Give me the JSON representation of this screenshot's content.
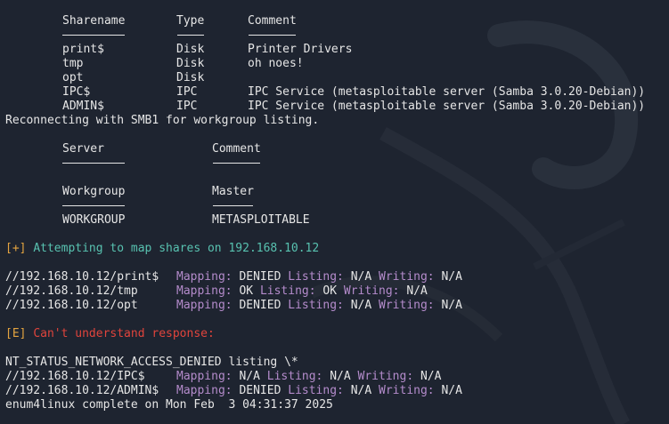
{
  "share_table": {
    "headers": {
      "name": "Sharename",
      "type": "Type",
      "comment": "Comment"
    },
    "rows": [
      {
        "name": "print$",
        "type": "Disk",
        "comment": "Printer Drivers"
      },
      {
        "name": "tmp",
        "type": "Disk",
        "comment": "oh noes!"
      },
      {
        "name": "opt",
        "type": "Disk",
        "comment": ""
      },
      {
        "name": "IPC$",
        "type": "IPC",
        "comment": "IPC Service (metasploitable server (Samba 3.0.20-Debian))"
      },
      {
        "name": "ADMIN$",
        "type": "IPC",
        "comment": "IPC Service (metasploitable server (Samba 3.0.20-Debian))"
      }
    ]
  },
  "reconnect_message": "Reconnecting with SMB1 for workgroup listing.",
  "server_table": {
    "headers": {
      "server": "Server",
      "comment": "Comment"
    }
  },
  "workgroup_table": {
    "headers": {
      "workgroup": "Workgroup",
      "master": "Master"
    },
    "row": {
      "workgroup": "WORKGROUP",
      "master": "METASPLOITABLE"
    }
  },
  "status_map": {
    "tag": "[+]",
    "text": "Attempting to map shares on 192.168.10.12"
  },
  "labels": {
    "mapping": "Mapping:",
    "listing": "Listing:",
    "writing": "Writing:"
  },
  "share_results": [
    {
      "path": "//192.168.10.12/print$",
      "mapping": "DENIED",
      "listing": "N/A",
      "writing": "N/A"
    },
    {
      "path": "//192.168.10.12/tmp",
      "mapping": "OK",
      "listing": "OK",
      "writing": "N/A"
    },
    {
      "path": "//192.168.10.12/opt",
      "mapping": "DENIED",
      "listing": "N/A",
      "writing": "N/A"
    }
  ],
  "error_status": {
    "tag": "[E]",
    "text": "Can't understand response:"
  },
  "nt_status_line": "NT_STATUS_NETWORK_ACCESS_DENIED listing \\*",
  "share_results_2": [
    {
      "path": "//192.168.10.12/IPC$",
      "mapping": "N/A",
      "listing": "N/A",
      "writing": "N/A"
    },
    {
      "path": "//192.168.10.12/ADMIN$",
      "mapping": "DENIED",
      "listing": "N/A",
      "writing": "N/A"
    }
  ],
  "complete_message": "enum4linux complete on Mon Feb  3 04:31:37 2025",
  "colors": {
    "background": "#1e2430",
    "text": "#e6e6e6",
    "label_purple": "#b58ccc",
    "bracket_orange": "#e4a440",
    "info_teal": "#58c2b0",
    "error_red": "#e0443c"
  }
}
